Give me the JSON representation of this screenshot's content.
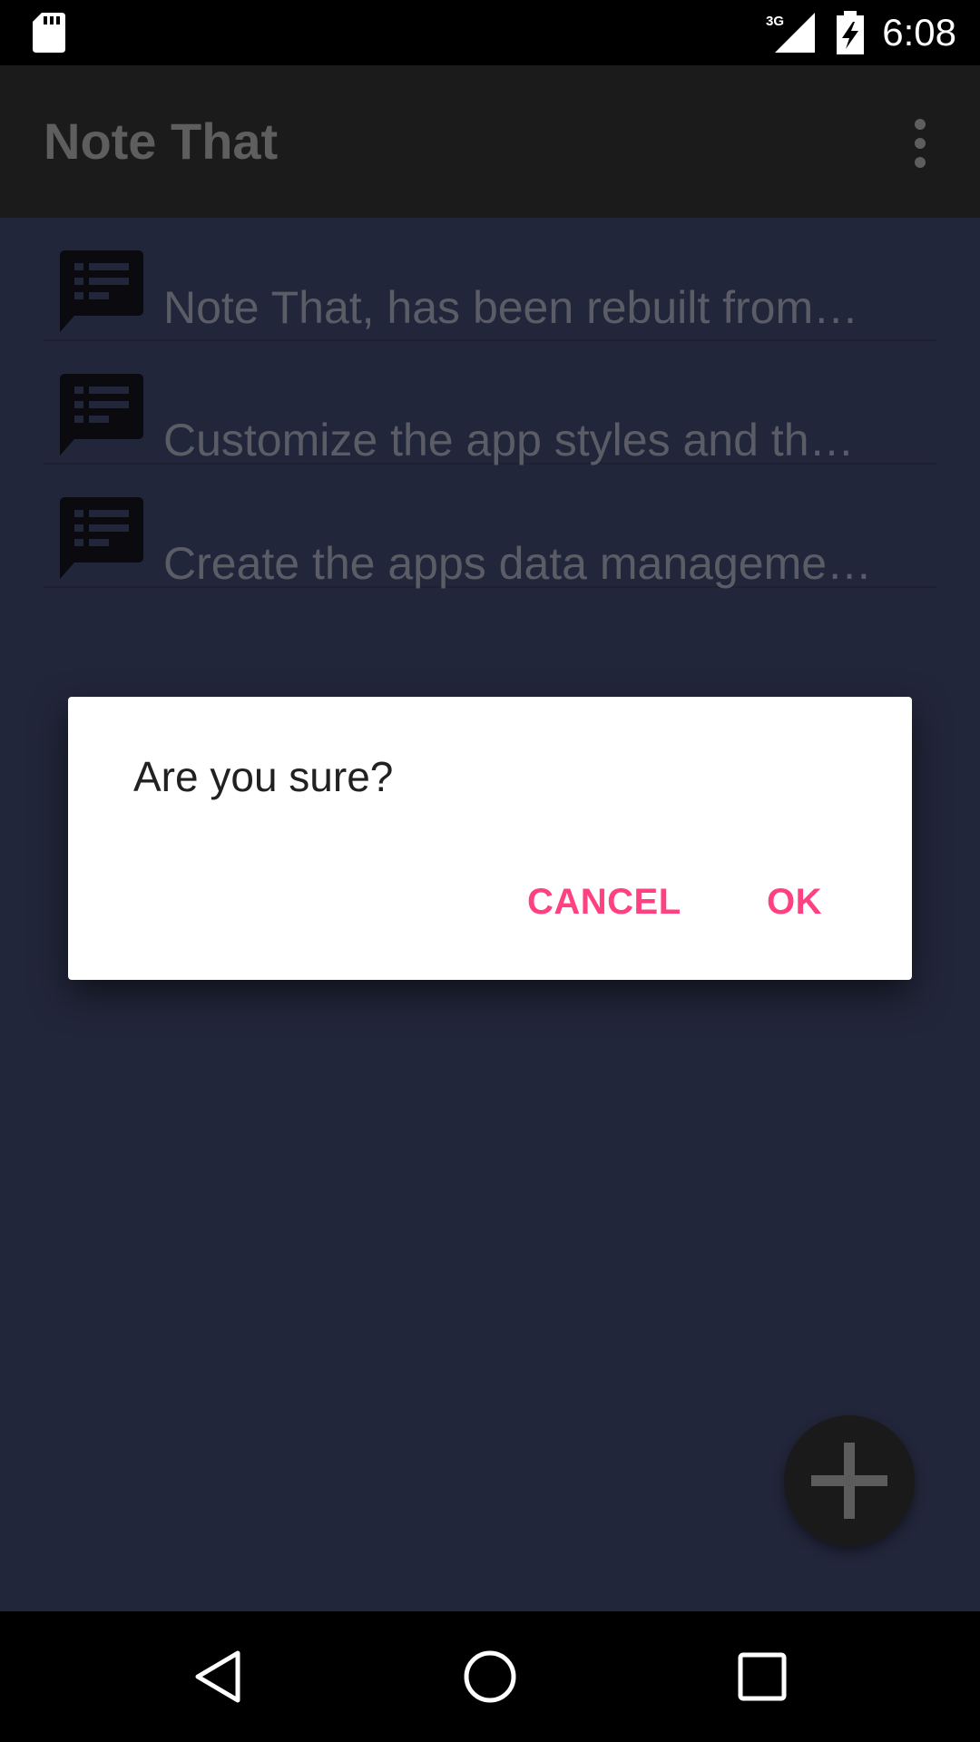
{
  "status_bar": {
    "time": "6:08",
    "network": "3G",
    "icons": [
      "sd-card-icon",
      "signal-3g-icon",
      "battery-charging-icon"
    ]
  },
  "app_bar": {
    "title": "Note That",
    "overflow_icon": "more-vert-icon"
  },
  "notes": [
    {
      "text": "Note That, has been rebuilt from…",
      "icon": "note-list-icon"
    },
    {
      "text": "Customize the app styles and th…",
      "icon": "note-list-icon"
    },
    {
      "text": "Create the apps data manageme…",
      "icon": "note-list-icon"
    }
  ],
  "dialog": {
    "message": "Are you sure?",
    "cancel_label": "CANCEL",
    "ok_label": "OK"
  },
  "fab": {
    "icon": "plus-icon"
  },
  "nav_bar": {
    "icons": [
      "back-icon",
      "home-icon",
      "recents-icon"
    ]
  },
  "colors": {
    "accent": "#ff4081",
    "background": "#22263a",
    "app_bar": "#1b1b1b"
  }
}
